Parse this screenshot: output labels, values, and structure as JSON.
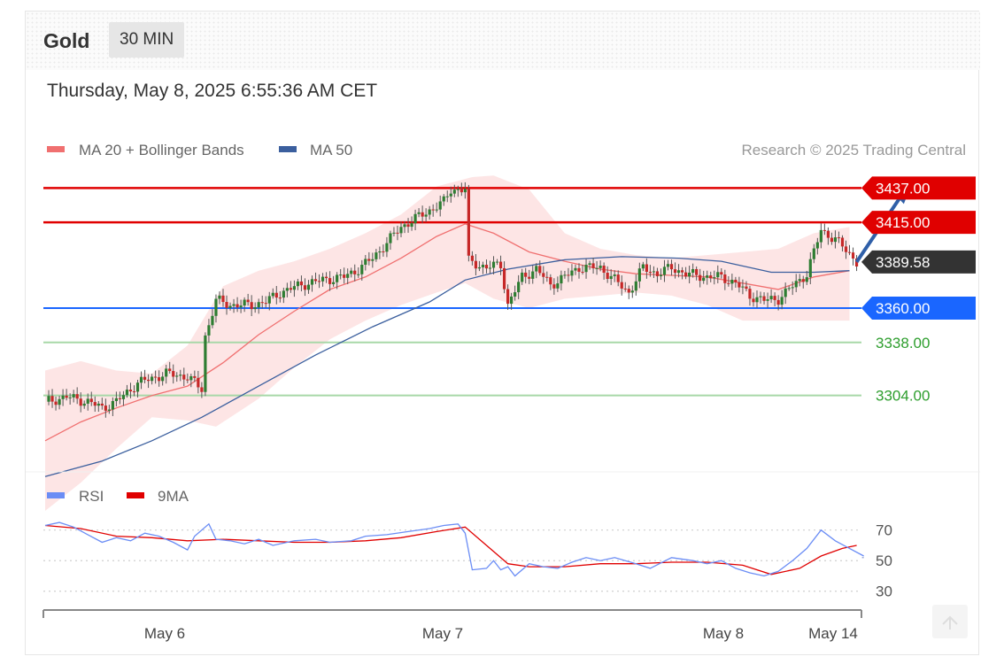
{
  "header": {
    "instrument": "Gold",
    "timeframe": "30 MIN"
  },
  "timestamp": "Thursday, May 8, 2025 6:55:36 AM CET",
  "legend": {
    "ma20": "MA 20 + Bollinger Bands",
    "ma50": "MA 50",
    "copyright": "Research © 2025 Trading Central",
    "rsi": "RSI",
    "rsi_ma": "9MA"
  },
  "colors": {
    "resistance": "#e00000",
    "support_key": "#1a66ff",
    "support_minor": "#2e9e2e",
    "last_price": "#333333",
    "ma20": "#f07070",
    "ma50": "#3b5f9e",
    "bollinger_fill": "#fde0e0",
    "rsi": "#6b8df5",
    "rsi_ma": "#e00000",
    "forecast_arrow": "#2f5fa8"
  },
  "chart_data": {
    "type": "candlestick",
    "price_axis": {
      "ylim": [
        3255,
        3465
      ]
    },
    "levels": [
      {
        "value": 3437.0,
        "label": "3437.00",
        "kind": "resistance"
      },
      {
        "value": 3415.0,
        "label": "3415.00",
        "kind": "resistance"
      },
      {
        "value": 3389.58,
        "label": "3389.58",
        "kind": "last"
      },
      {
        "value": 3360.0,
        "label": "3360.00",
        "kind": "support_key"
      },
      {
        "value": 3338.0,
        "label": "3338.00",
        "kind": "support_minor"
      },
      {
        "value": 3304.0,
        "label": "3304.00",
        "kind": "support_minor"
      }
    ],
    "x_ticks": [
      "May 6",
      "May 7",
      "May 8",
      "May 14"
    ],
    "close_path": [
      [
        0,
        3300
      ],
      [
        6,
        3303
      ],
      [
        12,
        3300
      ],
      [
        16,
        3296
      ],
      [
        20,
        3300
      ],
      [
        26,
        3312
      ],
      [
        34,
        3318
      ],
      [
        40,
        3316
      ],
      [
        44,
        3308
      ],
      [
        45,
        3342
      ],
      [
        48,
        3365
      ],
      [
        52,
        3362
      ],
      [
        58,
        3362
      ],
      [
        62,
        3364
      ],
      [
        66,
        3370
      ],
      [
        72,
        3375
      ],
      [
        78,
        3378
      ],
      [
        84,
        3380
      ],
      [
        88,
        3385
      ],
      [
        92,
        3392
      ],
      [
        96,
        3402
      ],
      [
        100,
        3412
      ],
      [
        106,
        3420
      ],
      [
        112,
        3428
      ],
      [
        114,
        3436
      ],
      [
        118,
        3436
      ],
      [
        119,
        3390
      ],
      [
        124,
        3386
      ],
      [
        128,
        3388
      ],
      [
        130,
        3362
      ],
      [
        134,
        3380
      ],
      [
        138,
        3385
      ],
      [
        142,
        3375
      ],
      [
        146,
        3380
      ],
      [
        150,
        3386
      ],
      [
        156,
        3386
      ],
      [
        160,
        3378
      ],
      [
        164,
        3370
      ],
      [
        168,
        3386
      ],
      [
        172,
        3382
      ],
      [
        176,
        3386
      ],
      [
        180,
        3382
      ],
      [
        186,
        3380
      ],
      [
        190,
        3380
      ],
      [
        194,
        3376
      ],
      [
        198,
        3368
      ],
      [
        202,
        3365
      ],
      [
        206,
        3366
      ],
      [
        210,
        3374
      ],
      [
        214,
        3382
      ],
      [
        218,
        3410
      ],
      [
        222,
        3404
      ],
      [
        226,
        3395
      ],
      [
        228,
        3389.58
      ]
    ],
    "ma20": [
      [
        0,
        3275
      ],
      [
        10,
        3287
      ],
      [
        20,
        3296
      ],
      [
        30,
        3304
      ],
      [
        40,
        3310
      ],
      [
        50,
        3325
      ],
      [
        60,
        3343
      ],
      [
        70,
        3358
      ],
      [
        80,
        3372
      ],
      [
        90,
        3380
      ],
      [
        100,
        3392
      ],
      [
        110,
        3406
      ],
      [
        118,
        3414
      ],
      [
        126,
        3408
      ],
      [
        136,
        3396
      ],
      [
        146,
        3390
      ],
      [
        156,
        3385
      ],
      [
        166,
        3382
      ],
      [
        176,
        3381
      ],
      [
        186,
        3380
      ],
      [
        196,
        3376
      ],
      [
        206,
        3372
      ],
      [
        216,
        3380
      ],
      [
        226,
        3384
      ]
    ],
    "ma50": [
      [
        0,
        3252
      ],
      [
        16,
        3262
      ],
      [
        30,
        3275
      ],
      [
        44,
        3290
      ],
      [
        60,
        3310
      ],
      [
        76,
        3330
      ],
      [
        92,
        3348
      ],
      [
        108,
        3364
      ],
      [
        118,
        3378
      ],
      [
        130,
        3385
      ],
      [
        146,
        3391
      ],
      [
        162,
        3393
      ],
      [
        178,
        3392
      ],
      [
        190,
        3390
      ],
      [
        204,
        3383
      ],
      [
        216,
        3383
      ],
      [
        226,
        3384
      ]
    ],
    "bollinger_upper": [
      [
        0,
        3320
      ],
      [
        10,
        3326
      ],
      [
        20,
        3320
      ],
      [
        30,
        3318
      ],
      [
        40,
        3336
      ],
      [
        50,
        3374
      ],
      [
        60,
        3384
      ],
      [
        70,
        3390
      ],
      [
        80,
        3398
      ],
      [
        90,
        3408
      ],
      [
        100,
        3420
      ],
      [
        110,
        3438
      ],
      [
        120,
        3444
      ],
      [
        126,
        3445
      ],
      [
        136,
        3436
      ],
      [
        146,
        3408
      ],
      [
        156,
        3398
      ],
      [
        166,
        3394
      ],
      [
        176,
        3392
      ],
      [
        186,
        3394
      ],
      [
        196,
        3396
      ],
      [
        206,
        3398
      ],
      [
        216,
        3408
      ],
      [
        226,
        3412
      ]
    ],
    "bollinger_lower": [
      [
        0,
        3230
      ],
      [
        10,
        3248
      ],
      [
        20,
        3270
      ],
      [
        30,
        3290
      ],
      [
        40,
        3288
      ],
      [
        48,
        3284
      ],
      [
        60,
        3302
      ],
      [
        70,
        3322
      ],
      [
        80,
        3340
      ],
      [
        90,
        3352
      ],
      [
        100,
        3362
      ],
      [
        110,
        3370
      ],
      [
        118,
        3376
      ],
      [
        126,
        3366
      ],
      [
        136,
        3360
      ],
      [
        146,
        3366
      ],
      [
        156,
        3368
      ],
      [
        166,
        3370
      ],
      [
        176,
        3368
      ],
      [
        186,
        3362
      ],
      [
        196,
        3352
      ],
      [
        206,
        3352
      ],
      [
        216,
        3352
      ],
      [
        226,
        3352
      ]
    ],
    "forecast_arrow": {
      "from": [
        228,
        3389.58
      ],
      "to": [
        243,
        3437
      ]
    },
    "rsi": {
      "ylim": [
        20,
        82
      ],
      "levels": [
        70,
        50,
        30
      ],
      "level_labels": [
        "70",
        "50",
        "30"
      ],
      "values": [
        [
          0,
          73
        ],
        [
          4,
          75
        ],
        [
          8,
          72
        ],
        [
          12,
          67
        ],
        [
          16,
          62
        ],
        [
          20,
          65
        ],
        [
          24,
          63
        ],
        [
          28,
          68
        ],
        [
          32,
          66
        ],
        [
          36,
          62
        ],
        [
          40,
          57
        ],
        [
          42,
          66
        ],
        [
          46,
          74
        ],
        [
          48,
          64
        ],
        [
          52,
          63
        ],
        [
          56,
          61
        ],
        [
          60,
          64
        ],
        [
          64,
          60
        ],
        [
          70,
          63
        ],
        [
          76,
          64
        ],
        [
          80,
          62
        ],
        [
          86,
          63
        ],
        [
          90,
          66
        ],
        [
          96,
          67
        ],
        [
          102,
          69
        ],
        [
          108,
          71
        ],
        [
          112,
          73
        ],
        [
          116,
          74
        ],
        [
          118,
          68
        ],
        [
          120,
          44
        ],
        [
          124,
          45
        ],
        [
          126,
          50
        ],
        [
          128,
          44
        ],
        [
          130,
          46
        ],
        [
          132,
          40
        ],
        [
          136,
          48
        ],
        [
          140,
          46
        ],
        [
          144,
          45
        ],
        [
          148,
          49
        ],
        [
          152,
          52
        ],
        [
          156,
          50
        ],
        [
          160,
          52
        ],
        [
          166,
          48
        ],
        [
          170,
          45
        ],
        [
          176,
          52
        ],
        [
          182,
          50
        ],
        [
          186,
          48
        ],
        [
          190,
          50
        ],
        [
          194,
          45
        ],
        [
          198,
          42
        ],
        [
          202,
          40
        ],
        [
          206,
          43
        ],
        [
          210,
          50
        ],
        [
          214,
          58
        ],
        [
          218,
          70
        ],
        [
          222,
          63
        ],
        [
          226,
          58
        ],
        [
          230,
          53
        ]
      ],
      "ma9": [
        [
          0,
          73
        ],
        [
          10,
          71
        ],
        [
          20,
          66
        ],
        [
          30,
          65
        ],
        [
          40,
          63
        ],
        [
          50,
          64
        ],
        [
          60,
          63
        ],
        [
          70,
          62
        ],
        [
          80,
          62
        ],
        [
          90,
          63
        ],
        [
          100,
          65
        ],
        [
          110,
          69
        ],
        [
          118,
          72
        ],
        [
          124,
          60
        ],
        [
          130,
          48
        ],
        [
          136,
          46
        ],
        [
          146,
          46
        ],
        [
          156,
          48
        ],
        [
          166,
          48
        ],
        [
          176,
          49
        ],
        [
          186,
          49
        ],
        [
          196,
          47
        ],
        [
          204,
          41
        ],
        [
          212,
          45
        ],
        [
          218,
          53
        ],
        [
          224,
          58
        ],
        [
          228,
          60
        ]
      ]
    }
  }
}
